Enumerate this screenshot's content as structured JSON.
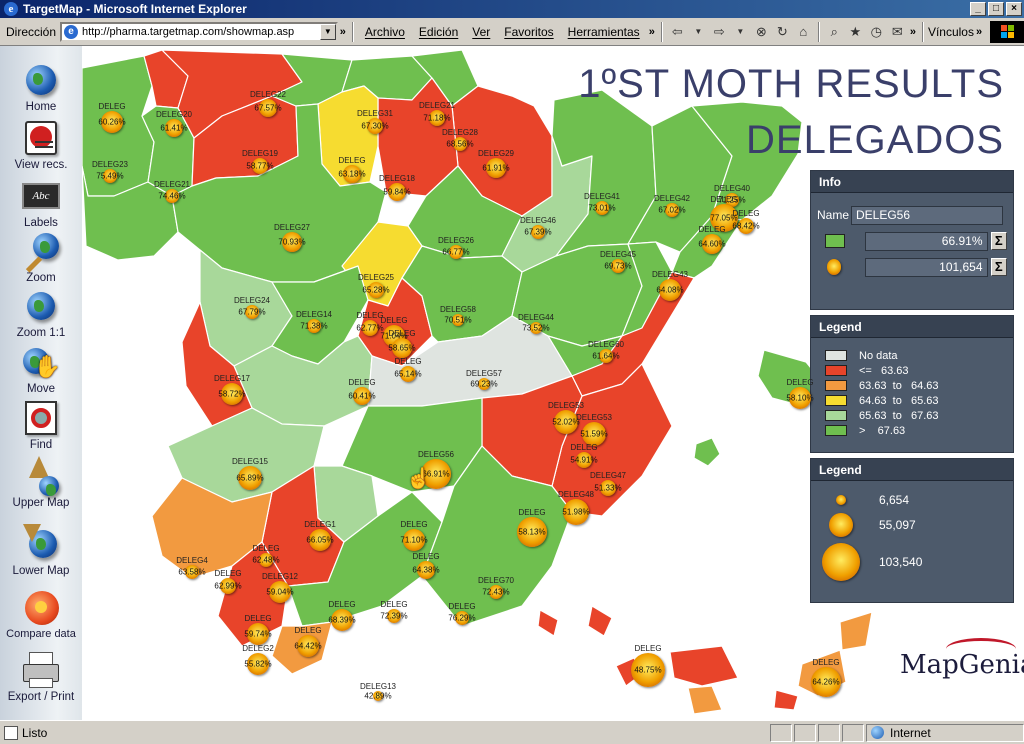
{
  "window": {
    "title": "TargetMap - Microsoft Internet Explorer",
    "buttons": [
      "_",
      "□",
      "×"
    ]
  },
  "addressbar": {
    "label": "Dirección",
    "url": "http://pharma.targetmap.com/showmap.asp",
    "menu": [
      "Archivo",
      "Edición",
      "Ver",
      "Favoritos",
      "Herramientas"
    ],
    "links_label": "Vínculos"
  },
  "sidebar": {
    "tools": [
      {
        "label": "Home",
        "icon": "home-globe-icon"
      },
      {
        "label": "View recs.",
        "icon": "records-icon"
      },
      {
        "label": "Labels",
        "icon": "labels-icon"
      },
      {
        "label": "Zoom",
        "icon": "zoom-icon"
      },
      {
        "label": "Zoom 1:1",
        "icon": "zoom-1-1-icon"
      },
      {
        "label": "Move",
        "icon": "move-hand-icon"
      },
      {
        "label": "Find",
        "icon": "find-icon"
      },
      {
        "label": "Upper Map",
        "icon": "upper-map-icon"
      },
      {
        "label": "Lower Map",
        "icon": "lower-map-icon"
      },
      {
        "label": "Compare data",
        "icon": "compare-icon"
      },
      {
        "label": "Export / Print",
        "icon": "printer-icon"
      }
    ]
  },
  "main": {
    "title_line1": "1ºST MOTH RESULTS",
    "title_line2": "DELEGADOS"
  },
  "info_panel": {
    "title": "Info",
    "name_label": "Name",
    "name_value": "DELEG56",
    "percent_value": "66.91%",
    "amount_value": "101,654",
    "sum_symbol": "Σ",
    "green_swatch": "#6fbf4f"
  },
  "legend_colors": {
    "title": "Legend",
    "items": [
      {
        "label": "No data",
        "color": "#dfe4e0"
      },
      {
        "label": "<=   63.63",
        "color": "#e8442a"
      },
      {
        "label": "63.63  to   64.63",
        "color": "#f29a40"
      },
      {
        "label": "64.63  to   65.63",
        "color": "#f6dc30"
      },
      {
        "label": "65.63  to   67.63",
        "color": "#a8d89a"
      },
      {
        "label": ">    67.63",
        "color": "#6fbf4f"
      }
    ]
  },
  "legend_sizes": {
    "title": "Legend",
    "items": [
      {
        "label": "6,654",
        "size": 10
      },
      {
        "label": "55,097",
        "size": 24
      },
      {
        "label": "103,540",
        "size": 38
      }
    ]
  },
  "map": {
    "colors": {
      "red": "#e8442a",
      "green": "#6fbf4f",
      "lightgreen": "#a8d89a",
      "yellow": "#f6dc30",
      "orange": "#f29a40",
      "nodata": "#dfe4e0",
      "sea": "#ffffff"
    },
    "regions": [
      {
        "name": "DELEG20",
        "pct": "61.41%"
      },
      {
        "name": "DELEG22",
        "pct": "67.57%"
      },
      {
        "name": "DELEG31",
        "pct": "67.30%"
      },
      {
        "name": "DELEG21",
        "pct": "71.18%"
      },
      {
        "name": "DELEG28",
        "pct": "68.56%"
      },
      {
        "name": "DELEG29",
        "pct": "61.91%"
      },
      {
        "name": "DELEG23",
        "pct": "75.49%"
      },
      {
        "name": "DELEG19",
        "pct": "58.77%"
      },
      {
        "name": "DELEG21",
        "pct": "74.46%"
      },
      {
        "name": "DELEG",
        "pct": "63.18%"
      },
      {
        "name": "DELEG18",
        "pct": "59.84%"
      },
      {
        "name": "DELEG41",
        "pct": "73.01%"
      },
      {
        "name": "DELEG42",
        "pct": "67.02%"
      },
      {
        "name": "DELEG40",
        "pct": "71.25%"
      },
      {
        "name": "DELEG27",
        "pct": "70.93%"
      },
      {
        "name": "DELEG46",
        "pct": "67.39%"
      },
      {
        "name": "DELEG26",
        "pct": "66.77%"
      },
      {
        "name": "DELEG45",
        "pct": "69.73%"
      },
      {
        "name": "DELEG43",
        "pct": "64.08%"
      },
      {
        "name": "DELEG25",
        "pct": "65.28%"
      },
      {
        "name": "DELEG24",
        "pct": "67.79%"
      },
      {
        "name": "DELEG14",
        "pct": "71.38%"
      },
      {
        "name": "DELEG58",
        "pct": "70.51%"
      },
      {
        "name": "DELEG44",
        "pct": "73.52%"
      },
      {
        "name": "DELEG60",
        "pct": "61.64%"
      },
      {
        "name": "DELEG17",
        "pct": "58.72%"
      },
      {
        "name": "DELEG57",
        "pct": "69.23%"
      },
      {
        "name": "DELEG",
        "pct": "60.41%"
      },
      {
        "name": "DELEG",
        "pct": "58.10%"
      },
      {
        "name": "DELEG53",
        "pct": "52.02%"
      },
      {
        "name": "DELEG53",
        "pct": "51.59%"
      },
      {
        "name": "DELEG",
        "pct": "54.91%"
      },
      {
        "name": "DELEG15",
        "pct": "65.89%"
      },
      {
        "name": "DELEG56",
        "pct": "66.91%"
      },
      {
        "name": "DELEG47",
        "pct": "51.33%"
      },
      {
        "name": "DELEG48",
        "pct": "51.98%"
      },
      {
        "name": "DELEG1",
        "pct": "66.05%"
      },
      {
        "name": "DELEG",
        "pct": "71.10%"
      },
      {
        "name": "DELEG",
        "pct": "58.13%"
      },
      {
        "name": "DELEG4",
        "pct": "63.58%"
      },
      {
        "name": "DELEG",
        "pct": "62.48%"
      },
      {
        "name": "DELEG12",
        "pct": "59.04%"
      },
      {
        "name": "DELEG",
        "pct": "64.38%"
      },
      {
        "name": "DELEG70",
        "pct": "72.43%"
      },
      {
        "name": "DELEG",
        "pct": "68.39%"
      },
      {
        "name": "DELEG",
        "pct": "72.39%"
      },
      {
        "name": "DELEG",
        "pct": "76.29%"
      },
      {
        "name": "DELEG",
        "pct": "59.74%"
      },
      {
        "name": "DELEG",
        "pct": "64.42%"
      },
      {
        "name": "DELEG2",
        "pct": "55.82%"
      },
      {
        "name": "DELEG",
        "pct": "48.75%"
      },
      {
        "name": "DELEG",
        "pct": "64.26%"
      },
      {
        "name": "DELEG13",
        "pct": "42.89%"
      },
      {
        "name": "DELEG",
        "pct": "62.99%"
      },
      {
        "name": "DELEG",
        "pct": "60.26%"
      },
      {
        "name": "DELEG",
        "pct": "77.05%"
      },
      {
        "name": "DELEG",
        "pct": "68.42%"
      },
      {
        "name": "DELEG",
        "pct": "64.60%"
      },
      {
        "name": "DELEG",
        "pct": "62.77%"
      },
      {
        "name": "DELEG",
        "pct": "71.04%"
      },
      {
        "name": "DELEG",
        "pct": "58.65%"
      },
      {
        "name": "DELEG",
        "pct": "65.14%"
      }
    ]
  },
  "logo": {
    "text": "MapGenia"
  },
  "status": {
    "left": "Listo",
    "zone": "Internet"
  }
}
